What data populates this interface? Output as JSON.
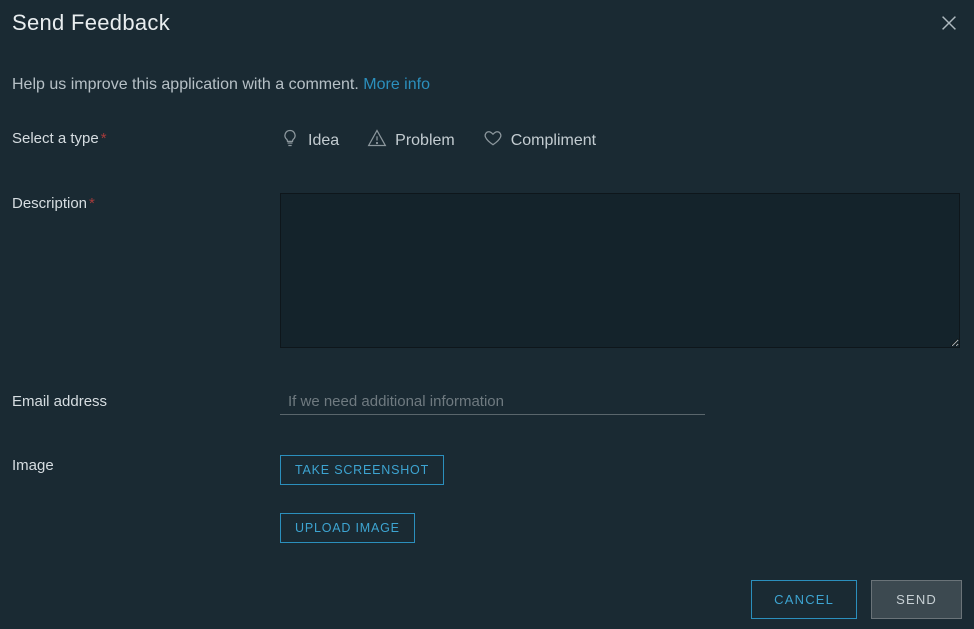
{
  "title": "Send Feedback",
  "help_text": "Help us improve this application with a comment. ",
  "more_info": "More info",
  "labels": {
    "select_type": "Select a type",
    "description": "Description",
    "email": "Email address",
    "image": "Image"
  },
  "types": {
    "idea": "Idea",
    "problem": "Problem",
    "compliment": "Compliment"
  },
  "email_placeholder": "If we need additional information",
  "buttons": {
    "take_screenshot": "TAKE SCREENSHOT",
    "upload_image": "UPLOAD IMAGE",
    "cancel": "CANCEL",
    "send": "SEND"
  }
}
